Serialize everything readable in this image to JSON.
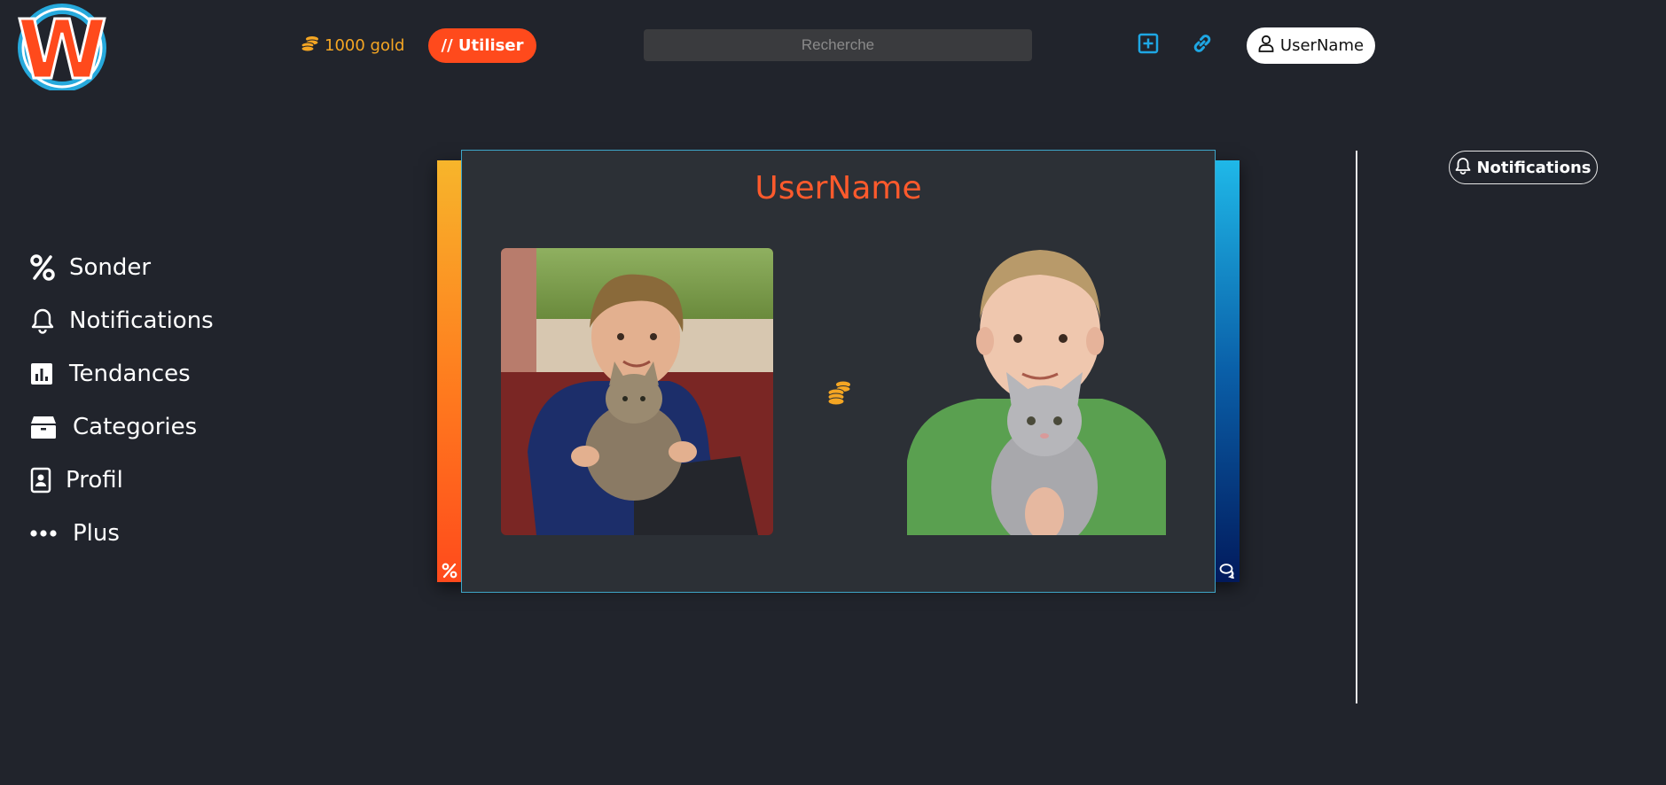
{
  "header": {
    "logo_letter": "W",
    "gold_label": "1000 gold",
    "use_button_label": "// Utiliser",
    "search_placeholder": "Recherche",
    "add_icon": "plus-square-icon",
    "link_icon": "link-icon",
    "user_button_label": "UserName"
  },
  "sidebar": {
    "items": [
      {
        "label": "Sonder",
        "icon": "percent-icon"
      },
      {
        "label": "Notifications",
        "icon": "bell-icon"
      },
      {
        "label": "Tendances",
        "icon": "bar-chart-icon"
      },
      {
        "label": "Categories",
        "icon": "box-icon"
      },
      {
        "label": "Profil",
        "icon": "id-badge-icon"
      },
      {
        "label": "Plus",
        "icon": "more-dots-icon"
      }
    ]
  },
  "card": {
    "title": "UserName",
    "left_strip_icon": "percent-icon",
    "right_strip_icon": "comments-icon",
    "middle_icon": "coins-icon"
  },
  "right_panel": {
    "notifications_label": "Notifications"
  },
  "colors": {
    "background": "#21242c",
    "accent_orange": "#ff4a1c",
    "gold": "#f5a623",
    "link_blue": "#1ea7e4",
    "card_bg": "#2c3036"
  }
}
